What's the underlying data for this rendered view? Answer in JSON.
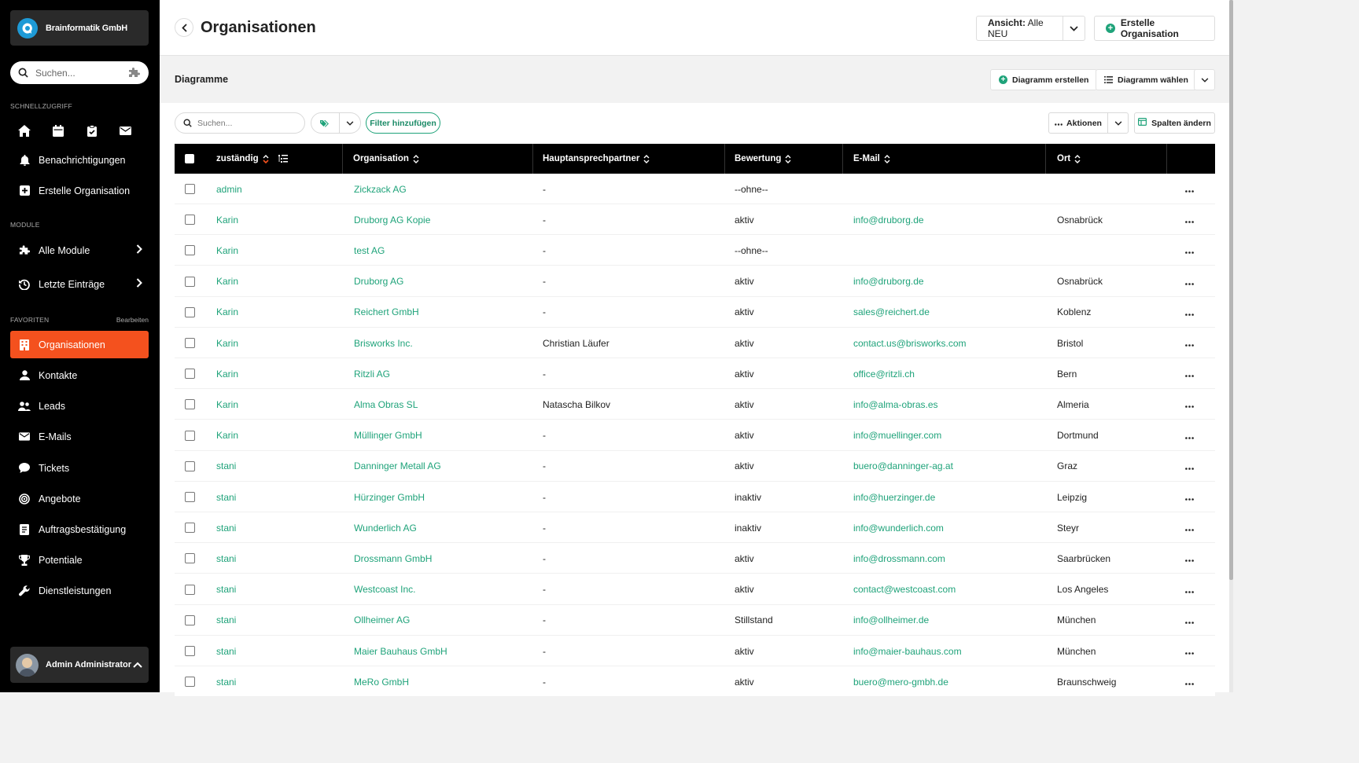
{
  "brand": {
    "name": "Brainformatik GmbH"
  },
  "sidebar": {
    "search_placeholder": "Suchen...",
    "quick_label": "Schnellzugriff",
    "modules_label": "Module",
    "favorites_label": "Favoriten",
    "favorites_edit": "Bearbeiten",
    "quick_items": [
      {
        "label": "Benachrichtigungen",
        "icon": "bell-icon"
      },
      {
        "label": "Erstelle Organisation",
        "icon": "plus-square-icon"
      }
    ],
    "module_items": [
      {
        "label": "Alle Module",
        "icon": "puzzle-icon"
      },
      {
        "label": "Letzte Einträge",
        "icon": "history-icon"
      }
    ],
    "favorite_items": [
      {
        "label": "Organisationen",
        "icon": "building-icon",
        "active": true
      },
      {
        "label": "Kontakte",
        "icon": "person-icon"
      },
      {
        "label": "Leads",
        "icon": "people-icon"
      },
      {
        "label": "E-Mails",
        "icon": "envelope-icon"
      },
      {
        "label": "Tickets",
        "icon": "chat-icon"
      },
      {
        "label": "Angebote",
        "icon": "target-icon"
      },
      {
        "label": "Auftragsbestätigung",
        "icon": "document-icon"
      },
      {
        "label": "Potentiale",
        "icon": "trophy-icon"
      },
      {
        "label": "Dienstleistungen",
        "icon": "wrench-icon"
      }
    ],
    "user_name": "Admin Administrator"
  },
  "header": {
    "title": "Organisationen",
    "view_label": "Ansicht:",
    "view_value": "Alle NEU",
    "create_label": "Erstelle Organisation"
  },
  "diagrams": {
    "title": "Diagramme",
    "create_label": "Diagramm erstellen",
    "choose_label": "Diagramm wählen"
  },
  "toolbar": {
    "search_placeholder": "Suchen...",
    "filter_label": "Filter hinzufügen",
    "actions_label": "Aktionen",
    "columns_label": "Spalten ändern"
  },
  "table": {
    "columns": [
      "zuständig",
      "Organisation",
      "Hauptansprechpartner",
      "Bewertung",
      "E-Mail",
      "Ort"
    ],
    "rows": [
      {
        "owner": "admin",
        "org": "Zickzack AG",
        "contact": "-",
        "rating": "--ohne--",
        "email": "",
        "city": ""
      },
      {
        "owner": "Karin",
        "org": "Druborg AG Kopie",
        "contact": "-",
        "rating": "aktiv",
        "email": "info@druborg.de",
        "city": "Osnabrück"
      },
      {
        "owner": "Karin",
        "org": "test AG",
        "contact": "-",
        "rating": "--ohne--",
        "email": "",
        "city": ""
      },
      {
        "owner": "Karin",
        "org": "Druborg AG",
        "contact": "-",
        "rating": "aktiv",
        "email": "info@druborg.de",
        "city": "Osnabrück"
      },
      {
        "owner": "Karin",
        "org": "Reichert GmbH",
        "contact": "-",
        "rating": "aktiv",
        "email": "sales@reichert.de",
        "city": "Koblenz"
      },
      {
        "owner": "Karin",
        "org": "Brisworks Inc.",
        "contact": "Christian Läufer",
        "rating": "aktiv",
        "email": "contact.us@brisworks.com",
        "city": "Bristol"
      },
      {
        "owner": "Karin",
        "org": "Ritzli AG",
        "contact": "-",
        "rating": "aktiv",
        "email": "office@ritzli.ch",
        "city": "Bern"
      },
      {
        "owner": "Karin",
        "org": "Alma Obras SL",
        "contact": "Natascha Bilkov",
        "rating": "aktiv",
        "email": "info@alma-obras.es",
        "city": "Almeria"
      },
      {
        "owner": "Karin",
        "org": "Müllinger GmbH",
        "contact": "-",
        "rating": "aktiv",
        "email": "info@muellinger.com",
        "city": "Dortmund"
      },
      {
        "owner": "stani",
        "org": "Danninger Metall AG",
        "contact": "-",
        "rating": "aktiv",
        "email": "buero@danninger-ag.at",
        "city": "Graz"
      },
      {
        "owner": "stani",
        "org": "Hürzinger GmbH",
        "contact": "-",
        "rating": "inaktiv",
        "email": "info@huerzinger.de",
        "city": "Leipzig"
      },
      {
        "owner": "stani",
        "org": "Wunderlich AG",
        "contact": "-",
        "rating": "inaktiv",
        "email": "info@wunderlich.com",
        "city": "Steyr"
      },
      {
        "owner": "stani",
        "org": "Drossmann GmbH",
        "contact": "-",
        "rating": "aktiv",
        "email": "info@drossmann.com",
        "city": "Saarbrücken"
      },
      {
        "owner": "stani",
        "org": "Westcoast Inc.",
        "contact": "-",
        "rating": "aktiv",
        "email": "contact@westcoast.com",
        "city": "Los Angeles"
      },
      {
        "owner": "stani",
        "org": "Ollheimer AG",
        "contact": "-",
        "rating": "Stillstand",
        "email": "info@ollheimer.de",
        "city": "München"
      },
      {
        "owner": "stani",
        "org": "Maier Bauhaus GmbH",
        "contact": "-",
        "rating": "aktiv",
        "email": "info@maier-bauhaus.com",
        "city": "München"
      },
      {
        "owner": "stani",
        "org": "MeRo GmbH",
        "contact": "-",
        "rating": "aktiv",
        "email": "buero@mero-gmbh.de",
        "city": "Braunschweig"
      }
    ]
  },
  "colors": {
    "accent": "#f4511e",
    "link": "#1fa37a",
    "sidebar": "#000000"
  }
}
